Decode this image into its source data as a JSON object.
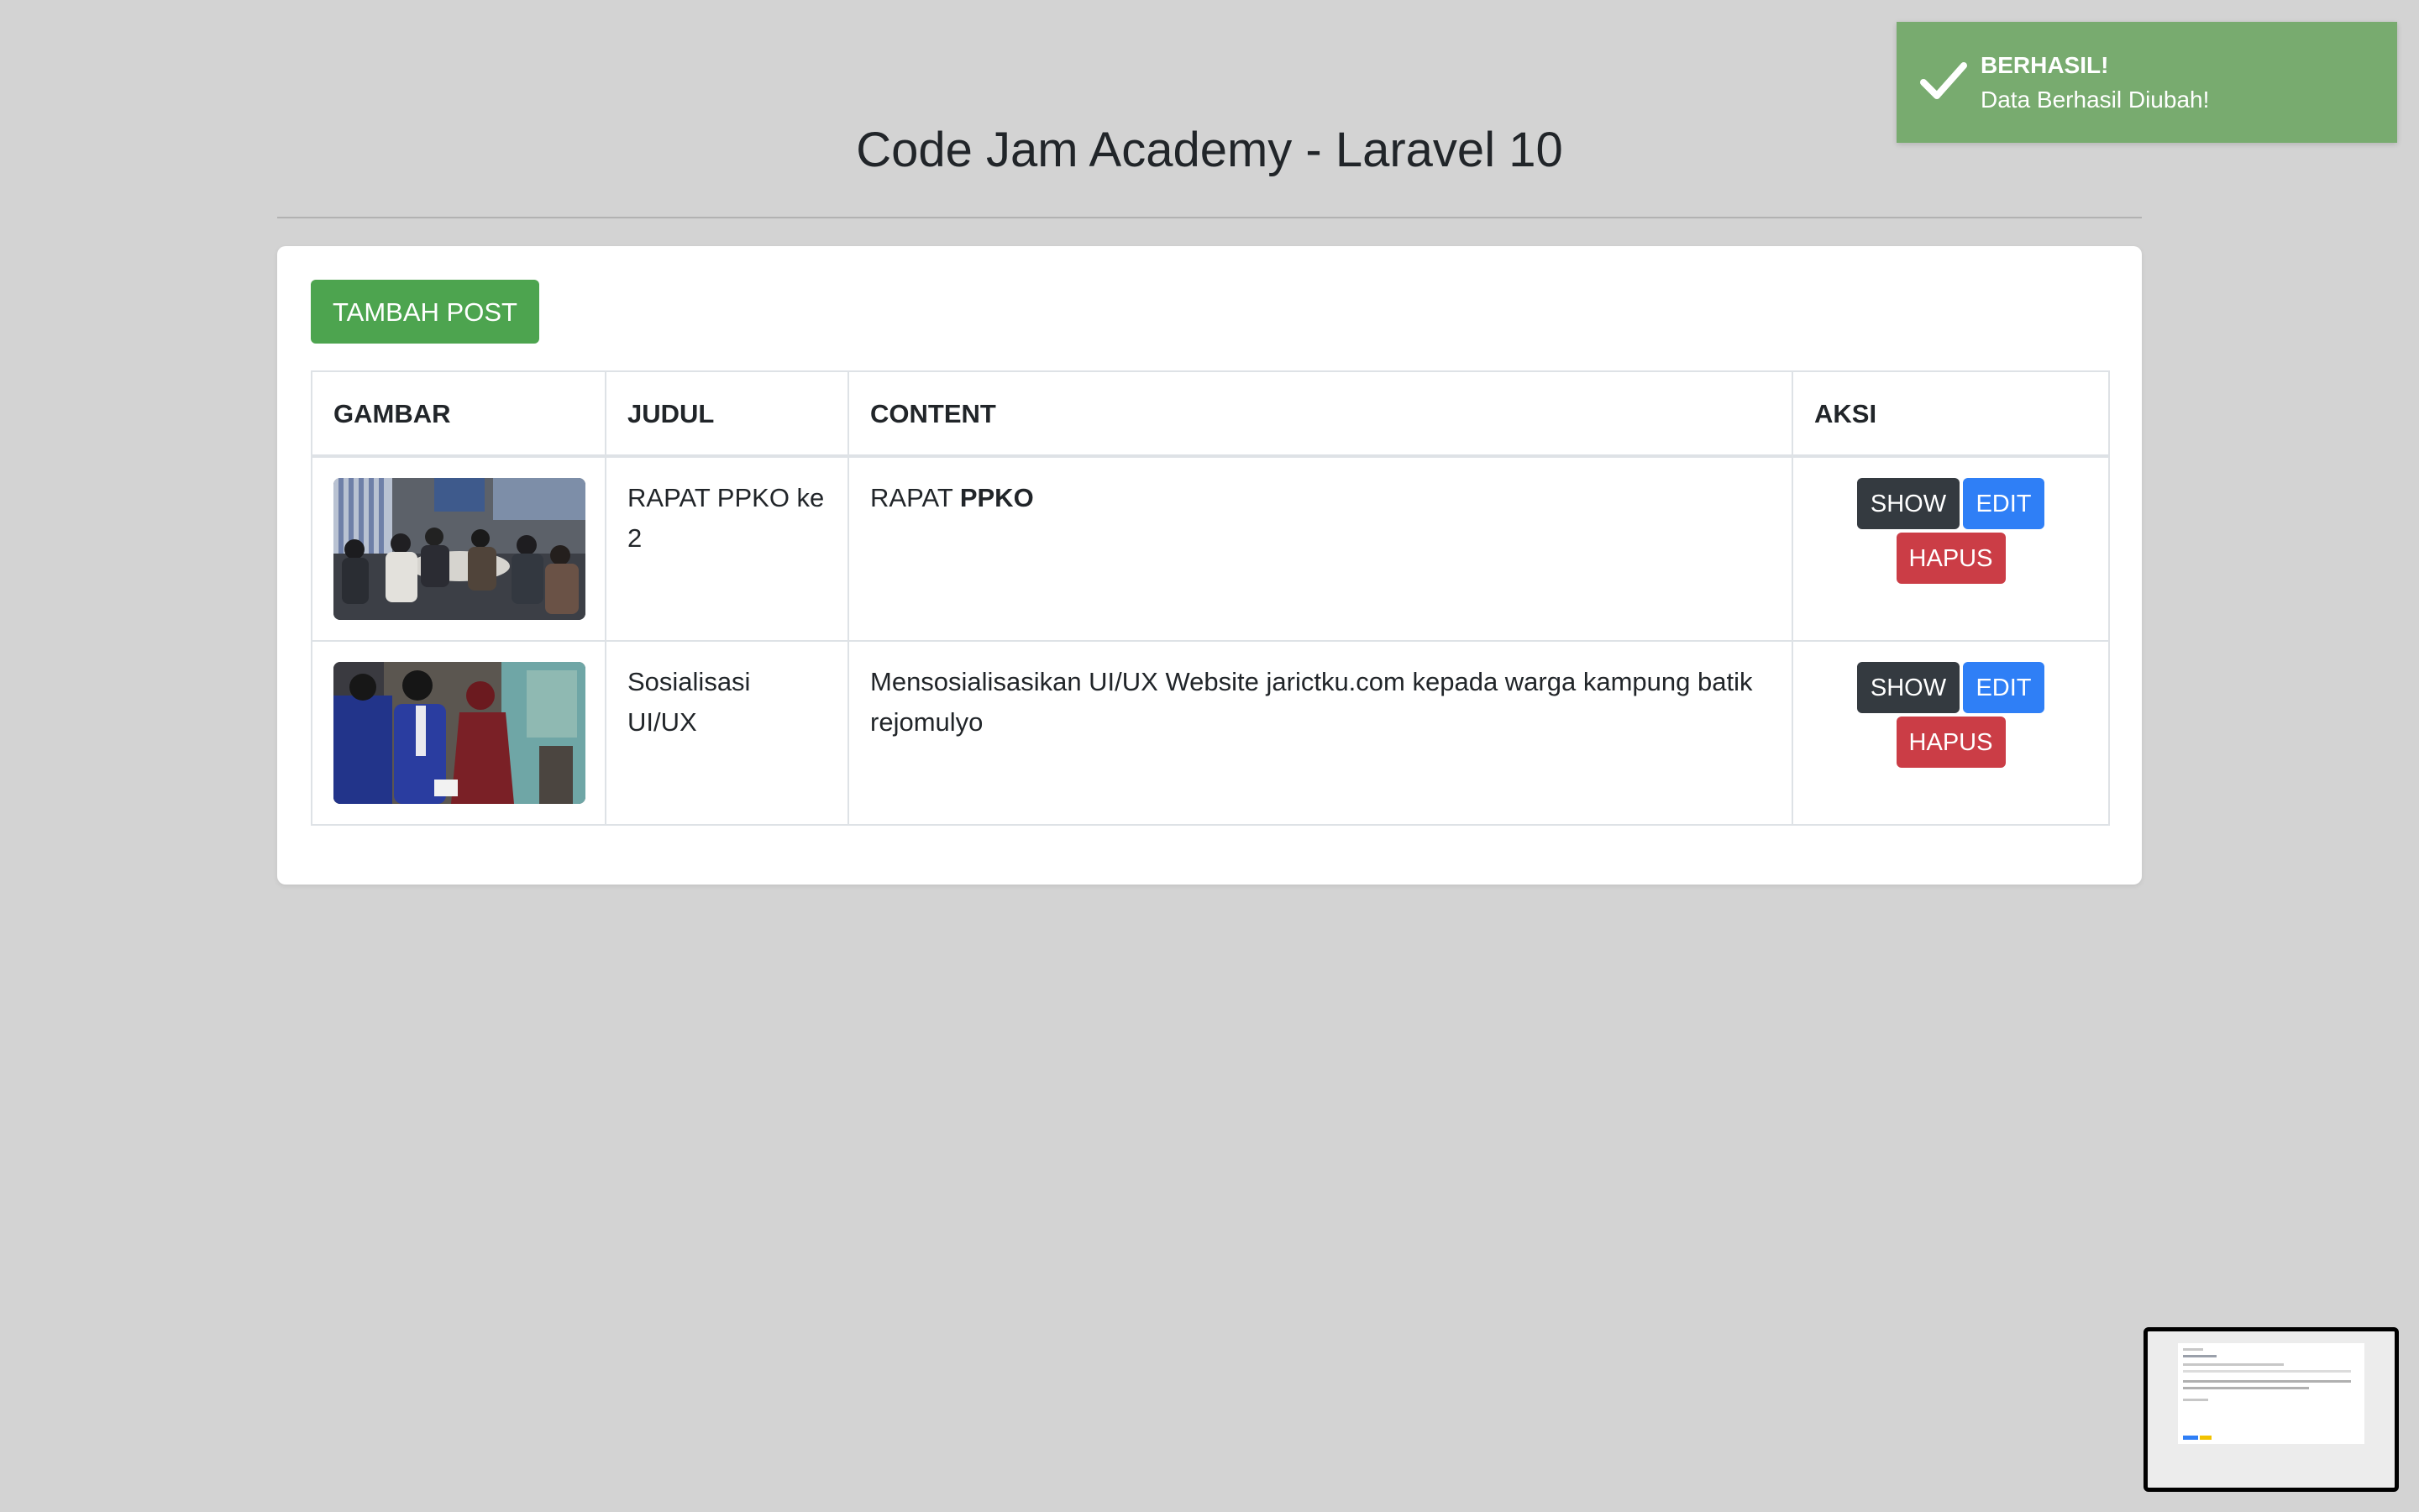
{
  "header": {
    "title": "Code Jam Academy - Laravel 10"
  },
  "toolbar": {
    "add_label": "TAMBAH POST"
  },
  "table": {
    "columns": [
      "GAMBAR",
      "JUDUL",
      "CONTENT",
      "AKSI"
    ],
    "rows": [
      {
        "image": "meeting-photo",
        "judul": "RAPAT PPKO ke 2",
        "content_plain": "RAPAT",
        "content_bold": "PPKO"
      },
      {
        "image": "socialization-photo",
        "judul": "Sosialisasi UI/UX",
        "content_plain": "Mensosialisasikan UI/UX Website jarictku.com kepada warga kampung batik rejomulyo",
        "content_bold": ""
      }
    ],
    "actions": {
      "show": "SHOW",
      "edit": "EDIT",
      "delete": "HAPUS"
    }
  },
  "toast": {
    "title": "BERHASIL!",
    "message": "Data Berhasil Diubah!",
    "icon": "check-icon"
  },
  "colors": {
    "background": "#d3d3d3",
    "add_button": "#4da44f",
    "show_button": "#343a40",
    "edit_button": "#2f7ff6",
    "delete_button": "#cb3d46",
    "toast": "#78ab6f"
  }
}
